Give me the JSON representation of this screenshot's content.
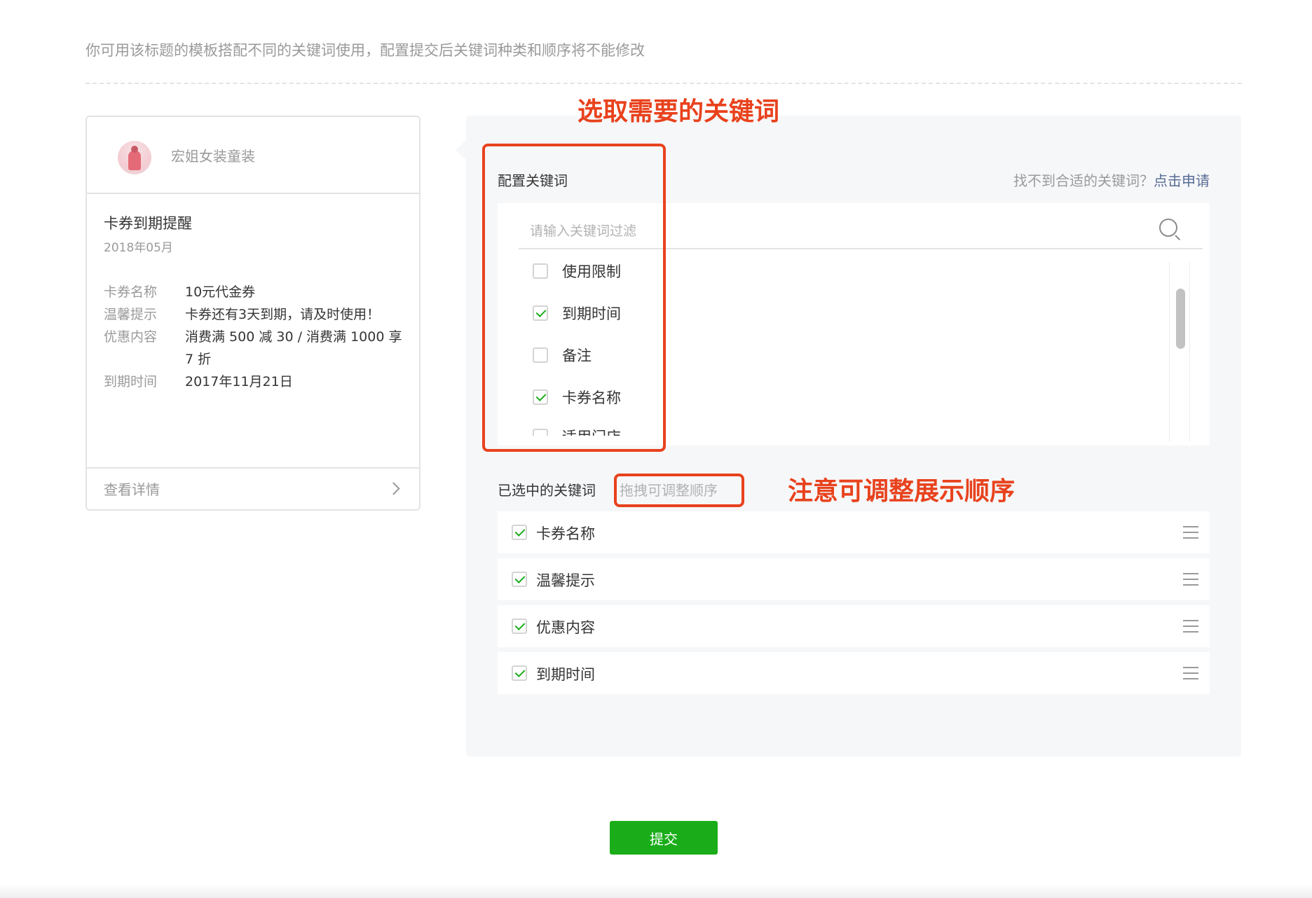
{
  "notice": "你可用该标题的模板搭配不同的关键词使用，配置提交后关键词种类和顺序将不能修改",
  "preview": {
    "shop_name": "宏姐女装童装",
    "title": "卡券到期提醒",
    "date": "2018年05月",
    "fields": [
      {
        "label": "卡券名称",
        "value": "10元代金券"
      },
      {
        "label": "温馨提示",
        "value": "卡券还有3天到期，请及时使用！"
      },
      {
        "label": "优惠内容",
        "value": "消费满 500 减 30 / 消费满 1000 享 7 折"
      },
      {
        "label": "到期时间",
        "value": "2017年11月21日"
      }
    ],
    "footer_link": "查看详情"
  },
  "config": {
    "label": "配置关键词",
    "help_prefix": "找不到合适的关键词？",
    "help_link": "点击申请",
    "search_placeholder": "请输入关键词过滤",
    "keywords": [
      {
        "label": "使用限制",
        "checked": false
      },
      {
        "label": "到期时间",
        "checked": true
      },
      {
        "label": "备注",
        "checked": false
      },
      {
        "label": "卡券名称",
        "checked": true
      },
      {
        "label": "适用门店",
        "checked": false
      }
    ],
    "selected_label": "已选中的关键词",
    "drag_hint": "拖拽可调整顺序",
    "selected": [
      {
        "label": "卡券名称"
      },
      {
        "label": "温馨提示"
      },
      {
        "label": "优惠内容"
      },
      {
        "label": "到期时间"
      }
    ]
  },
  "annotations": {
    "select_title": "选取需要的关键词",
    "order_title": "注意可调整展示顺序"
  },
  "submit_label": "提交",
  "colors": {
    "accent_green": "#1aad19",
    "annotation_red": "#e8421d",
    "link_blue": "#576b95"
  }
}
